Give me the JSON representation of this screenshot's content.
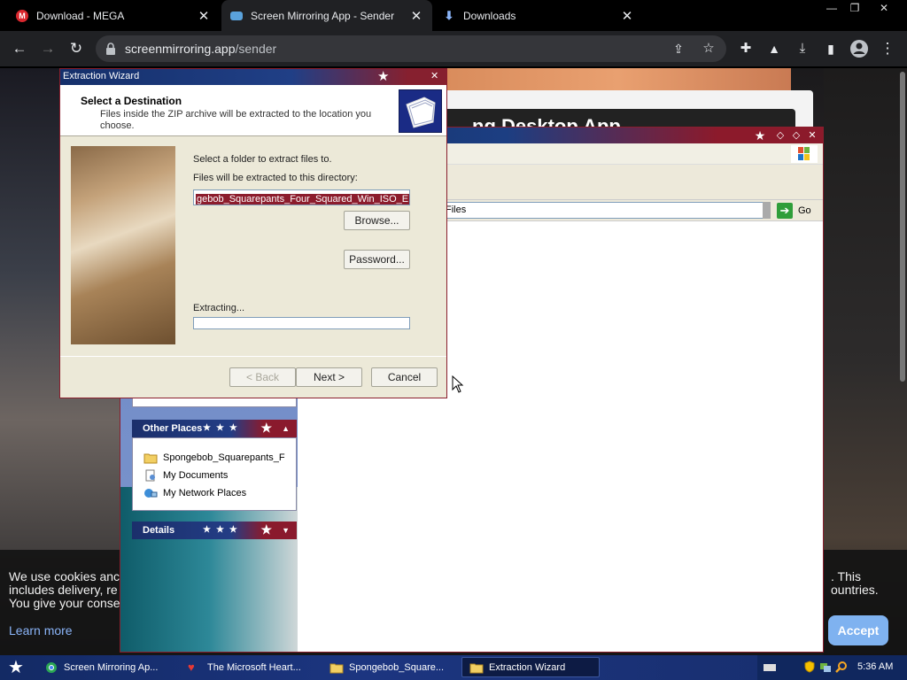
{
  "browser": {
    "tabs": [
      {
        "label": "Download - MEGA",
        "favicon": "M",
        "favicon_color": "#d9272e"
      },
      {
        "label": "Screen Mirroring App - Sender",
        "favicon": "",
        "favicon_color": "#5aa2dc"
      },
      {
        "label": "Downloads",
        "favicon": "",
        "favicon_color": "#8ab4f8"
      }
    ],
    "url_host": "screenmirroring.app",
    "url_path": "/sender",
    "window_controls": [
      "—",
      "❐",
      "✕"
    ]
  },
  "page": {
    "heading_fragment": "ng Desktop App",
    "cookie": {
      "text_left": "We use cookies and includes delivery, re You give your conse",
      "line1": "We use cookies anc",
      "line2": "includes delivery, re",
      "line3": "You give your conse",
      "right1": ". This",
      "right2": "ountries.",
      "learn_more": "Learn more",
      "accept": "Accept"
    }
  },
  "explorer": {
    "address_value": "Files",
    "go_label": "Go",
    "other_places": {
      "title": "Other Places",
      "items": [
        {
          "label": "Spongebob_Squarepants_F",
          "icon": "folder-icon"
        },
        {
          "label": "My Documents",
          "icon": "documents-icon"
        },
        {
          "label": "My Network Places",
          "icon": "network-icon"
        }
      ]
    },
    "details": {
      "title": "Details"
    }
  },
  "wizard": {
    "title": "Extraction Wizard",
    "header_title": "Select a Destination",
    "header_sub": "Files inside the ZIP archive will be extracted to the location you choose.",
    "select_label": "Select a folder to extract files to.",
    "dir_label": "Files will be extracted to this directory:",
    "dir_value": "gebob_Squarepants_Four_Squared_Win_ISO_EN",
    "browse": "Browse...",
    "password": "Password...",
    "extracting": "Extracting...",
    "progress": 0,
    "back": "< Back",
    "next": "Next >",
    "cancel": "Cancel"
  },
  "taskbar": {
    "tasks": [
      {
        "label": "Screen Mirroring Ap..."
      },
      {
        "label": "The Microsoft Heart..."
      },
      {
        "label": "Spongebob_Square..."
      },
      {
        "label": "Extraction Wizard"
      }
    ],
    "clock": "5:36 AM"
  }
}
